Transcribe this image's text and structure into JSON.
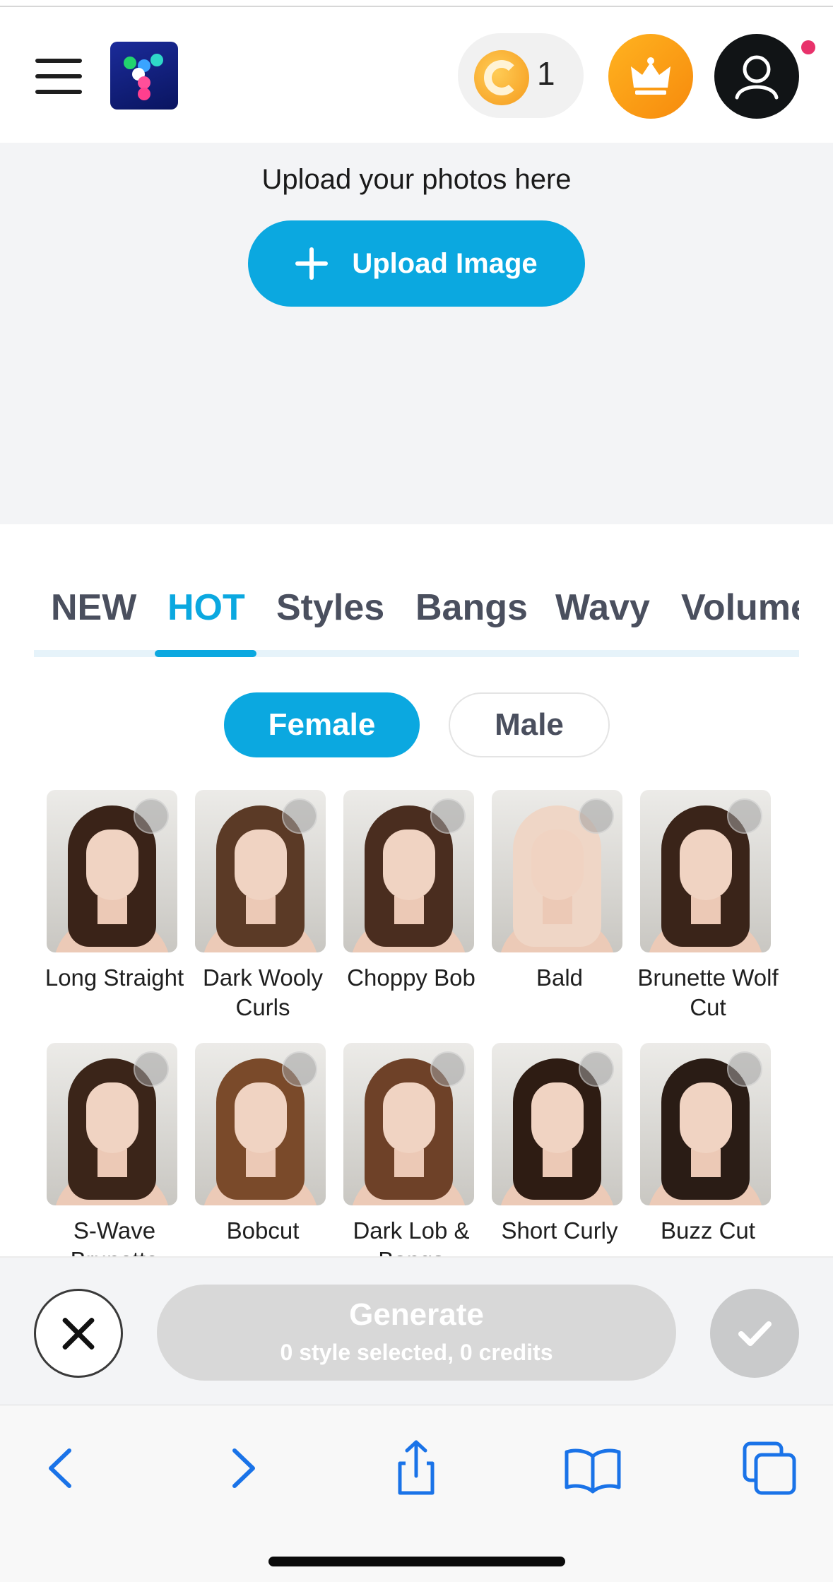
{
  "header": {
    "menu_icon": "hamburger-menu-icon",
    "logo_icon": "app-logo",
    "credits": "1",
    "colors": {
      "accent": "#0ba8e0",
      "crown": "#f8a016",
      "user": "#111416",
      "notification": "#e8326b"
    }
  },
  "upload": {
    "hint": "Upload your photos here",
    "button_label": "Upload Image",
    "icon": "plus-icon"
  },
  "tabs": [
    {
      "label": "NEW",
      "active": false
    },
    {
      "label": "HOT",
      "active": true
    },
    {
      "label": "Styles",
      "active": false
    },
    {
      "label": "Bangs",
      "active": false
    },
    {
      "label": "Wavy",
      "active": false
    },
    {
      "label": "Volume",
      "active": false
    }
  ],
  "gender": {
    "female": "Female",
    "male": "Male",
    "selected": "Female"
  },
  "styles": [
    {
      "name": "Long Straight",
      "hair_color": "#3a2318"
    },
    {
      "name": "Dark Wooly Curls",
      "hair_color": "#5b3a26"
    },
    {
      "name": "Choppy Bob",
      "hair_color": "#4a2d1f"
    },
    {
      "name": "Bald",
      "hair_color": "#efd6c6"
    },
    {
      "name": "Brunette Wolf Cut",
      "hair_color": "#3a2419"
    },
    {
      "name": "S-Wave Brunette",
      "hair_color": "#3b2519"
    },
    {
      "name": "Bobcut",
      "hair_color": "#7a4a2a"
    },
    {
      "name": "Dark Lob & Bangs",
      "hair_color": "#6e4128"
    },
    {
      "name": "Short Curly",
      "hair_color": "#2e1c13"
    },
    {
      "name": "Buzz Cut",
      "hair_color": "#2a1c15"
    }
  ],
  "action_bar": {
    "generate_title": "Generate",
    "generate_subtitle": "0 style selected, 0 credits",
    "cancel_icon": "close-icon",
    "confirm_icon": "checkmark-icon"
  },
  "browser": {
    "icons": [
      "back-icon",
      "forward-icon",
      "share-icon",
      "bookmarks-icon",
      "tabs-icon"
    ],
    "tint": "#1a73e8"
  }
}
